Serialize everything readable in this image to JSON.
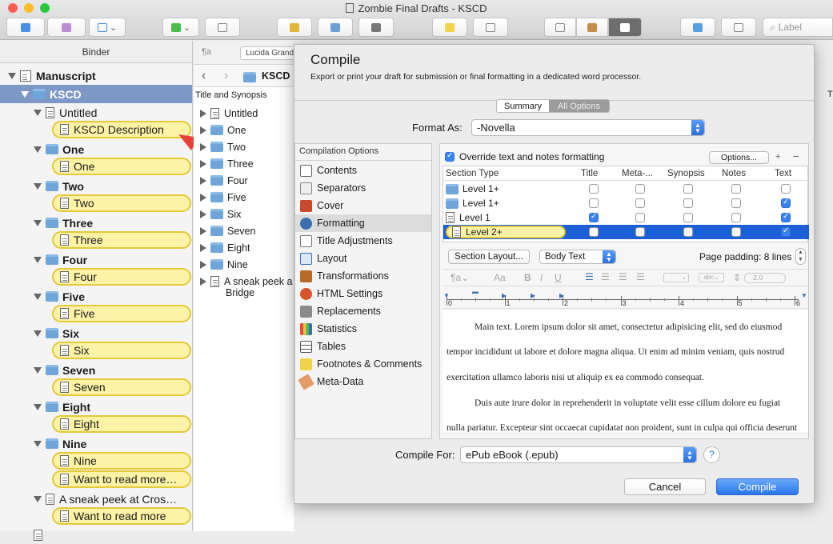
{
  "window": {
    "title": "Zombie Final Drafts - KSCD"
  },
  "toolbar": {
    "label_search": "Label"
  },
  "binder": {
    "header": "Binder",
    "items": [
      {
        "label": "Manuscript",
        "kind": "root"
      },
      {
        "label": "KSCD",
        "kind": "folder"
      },
      {
        "label": "Untitled",
        "kind": "doc"
      },
      {
        "label": "KSCD Description",
        "kind": "pill"
      },
      {
        "label": "One",
        "kind": "folder"
      },
      {
        "label": "One",
        "kind": "pill"
      },
      {
        "label": "Two",
        "kind": "folder"
      },
      {
        "label": "Two",
        "kind": "pill"
      },
      {
        "label": "Three",
        "kind": "folder"
      },
      {
        "label": "Three",
        "kind": "pill"
      },
      {
        "label": "Four",
        "kind": "folder"
      },
      {
        "label": "Four",
        "kind": "pill"
      },
      {
        "label": "Five",
        "kind": "folder"
      },
      {
        "label": "Five",
        "kind": "pill"
      },
      {
        "label": "Six",
        "kind": "folder"
      },
      {
        "label": "Six",
        "kind": "pill"
      },
      {
        "label": "Seven",
        "kind": "folder"
      },
      {
        "label": "Seven",
        "kind": "pill"
      },
      {
        "label": "Eight",
        "kind": "folder"
      },
      {
        "label": "Eight",
        "kind": "pill"
      },
      {
        "label": "Nine",
        "kind": "folder"
      },
      {
        "label": "Nine",
        "kind": "pill"
      },
      {
        "label": "Want to read more…",
        "kind": "pill"
      },
      {
        "label": "A sneak peek at Cros…",
        "kind": "doc"
      },
      {
        "label": "Want to read more",
        "kind": "pill"
      }
    ]
  },
  "editor": {
    "format_selector": "¶a",
    "font": "Lucida Grand",
    "breadcrumb": "KSCD",
    "column_header": "Title and Synopsis",
    "right_header": "T",
    "items": [
      "Untitled",
      "One",
      "Two",
      "Three",
      "Four",
      "Five",
      "Six",
      "Seven",
      "Eight",
      "Nine",
      "A sneak peek a",
      "Bridge"
    ]
  },
  "compile": {
    "title": "Compile",
    "subtitle": "Export or print your draft for submission or final formatting in a dedicated word processor.",
    "tabs": [
      "Summary",
      "All Options"
    ],
    "format_label": "Format As:",
    "format_value": "-Novella",
    "options_header": "Compilation Options",
    "options": [
      "Contents",
      "Separators",
      "Cover",
      "Formatting",
      "Title Adjustments",
      "Layout",
      "Transformations",
      "HTML Settings",
      "Replacements",
      "Statistics",
      "Tables",
      "Footnotes & Comments",
      "Meta-Data"
    ],
    "override_label": "Override text and notes formatting",
    "options_button": "Options...",
    "columns": [
      "Section Type",
      "Title",
      "Meta-...",
      "Synopsis",
      "Notes",
      "Text"
    ],
    "rows": [
      {
        "label": "Level  1+",
        "icon": "folder",
        "checks": [
          false,
          false,
          false,
          false,
          false
        ]
      },
      {
        "label": "Level  1+",
        "icon": "folder",
        "checks": [
          false,
          false,
          false,
          false,
          true
        ]
      },
      {
        "label": "Level  1",
        "icon": "doc",
        "checks": [
          true,
          false,
          false,
          false,
          true
        ]
      },
      {
        "label": "Level  2+",
        "icon": "doc",
        "checks": [
          false,
          false,
          false,
          false,
          true
        ]
      }
    ],
    "section_layout_button": "Section Layout...",
    "style_value": "Body Text",
    "page_padding": "Page padding: 8 lines",
    "line_spacing": "2.0",
    "ruler_numbers": [
      "0",
      "1",
      "2",
      "3",
      "4",
      "5",
      "6"
    ],
    "preview": [
      "Main text. Lorem ipsum dolor sit amet, consectetur adipisicing elit, sed do eiusmod",
      "tempor incididunt ut labore et dolore magna aliqua. Ut enim ad minim veniam, quis nostrud",
      "exercitation ullamco laboris nisi ut aliquip ex ea commodo consequat.",
      "Duis aute irure dolor in reprehenderit in voluptate velit esse cillum dolore eu fugiat",
      "nulla pariatur. Excepteur sint occaecat cupidatat non proident, sunt in culpa qui officia deserunt"
    ],
    "compile_for_label": "Compile For:",
    "compile_for_value": "ePub eBook (.epub)",
    "help": "?",
    "cancel": "Cancel",
    "compile_button": "Compile"
  },
  "colors": {
    "accent": "#1c5fd6",
    "selection": "#7d98c6",
    "pill": "#fdf3a6",
    "arrow": "#e8413a"
  }
}
